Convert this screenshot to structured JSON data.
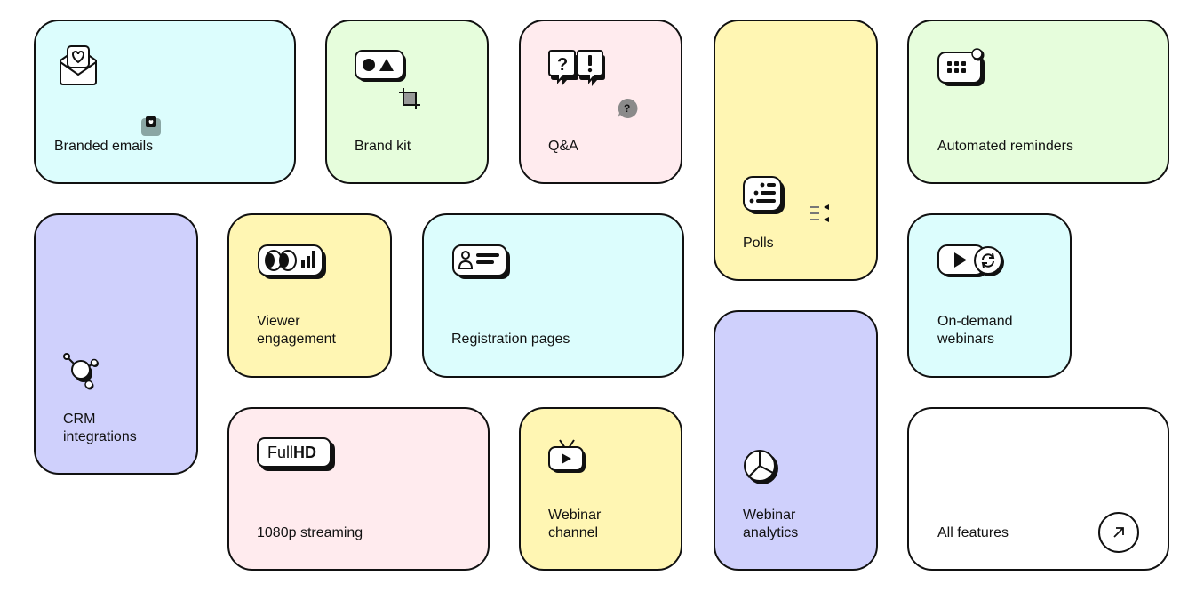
{
  "features": {
    "branded_emails": "Branded emails",
    "brand_kit": "Brand kit",
    "qa": "Q&A",
    "polls": "Polls",
    "automated_reminders": "Automated reminders",
    "crm_integrations": "CRM\nintegrations",
    "viewer_engagement": "Viewer\nengagement",
    "registration_pages": "Registration pages",
    "on_demand_webinars": "On-demand\nwebinars",
    "streaming_1080p": "1080p streaming",
    "webinar_channel": "Webinar\nchannel",
    "webinar_analytics": "Webinar\nanalytics",
    "all_features": "All features"
  },
  "badges": {
    "fullhd_light": "Full",
    "fullhd_bold": "HD"
  },
  "colors": {
    "cyan": "#dcfdfd",
    "green": "#e6fddc",
    "pink": "#ffebee",
    "yellow": "#fff6b3",
    "purple": "#cfd0fc",
    "white": "#ffffff",
    "outline": "#111111"
  },
  "icons": [
    "envelope-heart-icon",
    "shapes-icon",
    "crop-icon",
    "question-exclamation-bubbles-icon",
    "help-bubble-icon",
    "poll-list-icon",
    "keypad-reminder-icon",
    "molecule-icon",
    "eyes-chart-icon",
    "user-card-icon",
    "play-replay-icon",
    "fullhd-icon",
    "tv-play-icon",
    "pie-chart-icon",
    "arrow-up-right-icon"
  ]
}
